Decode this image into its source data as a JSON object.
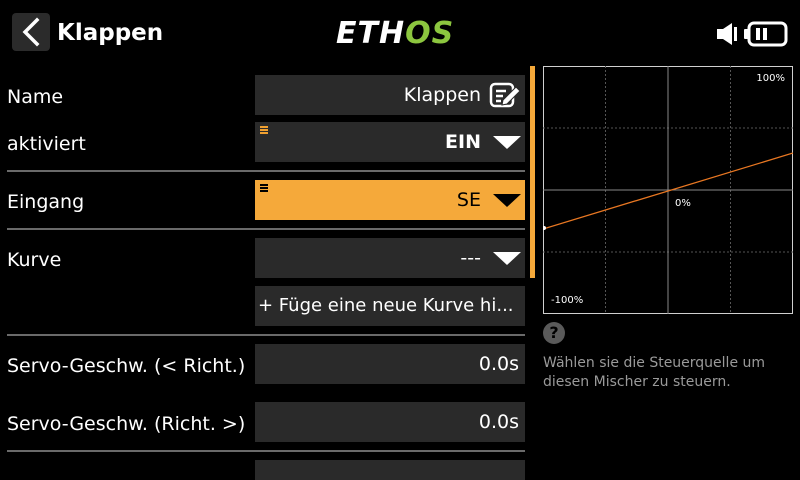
{
  "header": {
    "title": "Klappen",
    "logo_left": "ETH",
    "logo_right": "OS"
  },
  "form": {
    "name": {
      "label": "Name",
      "value": "Klappen"
    },
    "activated": {
      "label": "aktiviert",
      "value": "EIN"
    },
    "input": {
      "label": "Eingang",
      "value": "SE"
    },
    "curve": {
      "label": "Kurve",
      "value": "---",
      "add_button": "+ Füge eine neue Kurve hi..."
    },
    "servo_speed_down": {
      "label": "Servo-Geschw. (< Richt.)",
      "value": "0.0s"
    },
    "servo_speed_up": {
      "label": "Servo-Geschw. (Richt. >)",
      "value": "0.0s"
    }
  },
  "graph": {
    "top_label": "100%",
    "center_label": "0%",
    "bottom_label": "-100%",
    "line_color": "#e87722"
  },
  "help": {
    "icon": "?",
    "text": "Wählen sie die Steuerquelle um diesen Mischer zu steuern."
  },
  "colors": {
    "accent": "#f5a93a",
    "logo_green": "#8cc63f"
  }
}
